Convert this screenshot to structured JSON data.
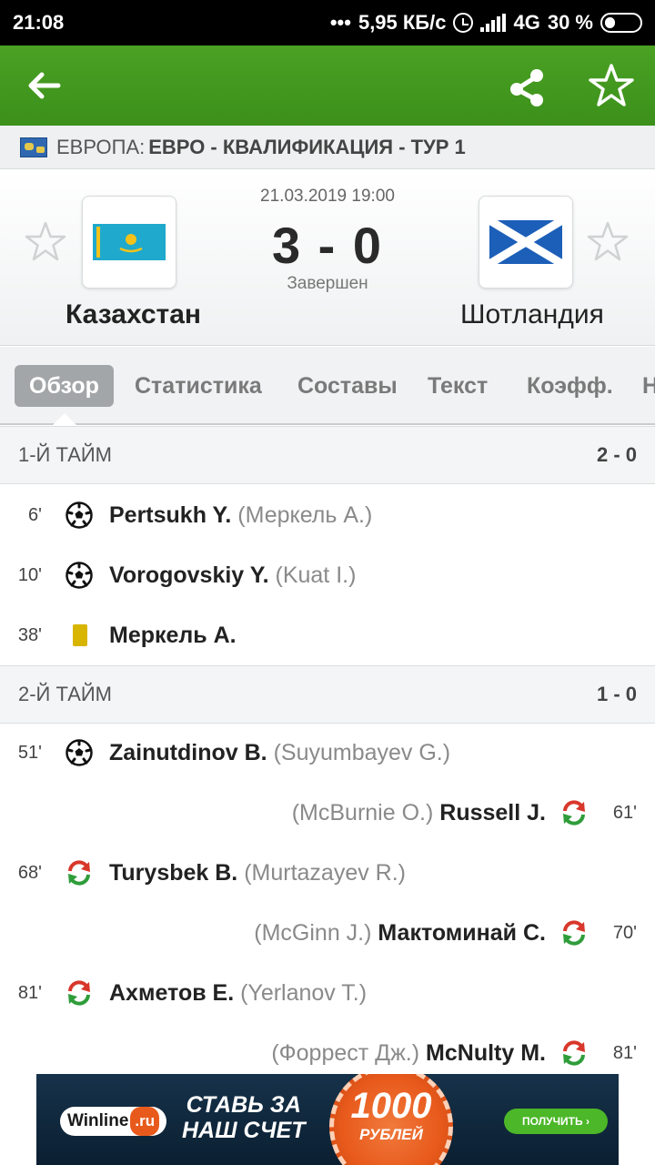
{
  "status_bar": {
    "time": "21:08",
    "dots": "•••",
    "speed": "5,95 КБ/с",
    "network": "4G",
    "battery": "30 %",
    "battery_level": 0.3
  },
  "app_bar": {
    "back_icon": "arrow-left-icon",
    "share_icon": "share-icon",
    "favorite_icon": "star-outline-icon",
    "accent_color": "#3f951e"
  },
  "league": {
    "country": "ЕВРОПА:",
    "competition": "ЕВРО - КВАЛИФИКАЦИЯ - ТУР 1"
  },
  "match": {
    "date": "21.03.2019 19:00",
    "score": "3 - 0",
    "status": "Завершен",
    "home": {
      "name": "Казахстан",
      "flag": "kazakhstan-flag"
    },
    "away": {
      "name": "Шотландия",
      "flag": "scotland-flag"
    }
  },
  "tabs": [
    "Обзор",
    "Статистика",
    "Составы",
    "Текст",
    "Коэфф.",
    "Н"
  ],
  "active_tab": "Обзор",
  "sections": [
    {
      "title": "1-Й ТАЙМ",
      "score": "2 - 0",
      "events": [
        {
          "side": "home",
          "minute": "6'",
          "type": "goal",
          "player": "Pertsukh Y.",
          "assist": "(Меркель А.)"
        },
        {
          "side": "home",
          "minute": "10'",
          "type": "goal",
          "player": "Vorogovskiy Y.",
          "assist": "(Kuat I.)"
        },
        {
          "side": "home",
          "minute": "38'",
          "type": "yellow-card",
          "player": "Меркель А.",
          "assist": ""
        }
      ]
    },
    {
      "title": "2-Й ТАЙМ",
      "score": "1 - 0",
      "events": [
        {
          "side": "home",
          "minute": "51'",
          "type": "goal",
          "player": "Zainutdinov B.",
          "assist": "(Suyumbayev G.)"
        },
        {
          "side": "away",
          "minute": "61'",
          "type": "substitution",
          "player": "Russell J.",
          "assist": "(McBurnie O.)"
        },
        {
          "side": "home",
          "minute": "68'",
          "type": "substitution",
          "player": "Turysbek B.",
          "assist": "(Murtazayev R.)"
        },
        {
          "side": "away",
          "minute": "70'",
          "type": "substitution",
          "player": "Мактоминай С.",
          "assist": "(McGinn J.)"
        },
        {
          "side": "home",
          "minute": "81'",
          "type": "substitution",
          "player": "Ахметов Е.",
          "assist": "(Yerlanov T.)"
        },
        {
          "side": "away",
          "minute": "81'",
          "type": "substitution",
          "player": "McNulty M.",
          "assist": "(Форрест Дж.)"
        }
      ]
    }
  ],
  "ad": {
    "brand": "Winline",
    "brand_suffix": ".ru",
    "slogan_line1": "СТАВЬ ЗА",
    "slogan_line2": "НАШ СЧЕТ",
    "amount": "1000",
    "currency": "РУБЛЕЙ",
    "cta": "ПОЛУЧИТЬ ›"
  }
}
